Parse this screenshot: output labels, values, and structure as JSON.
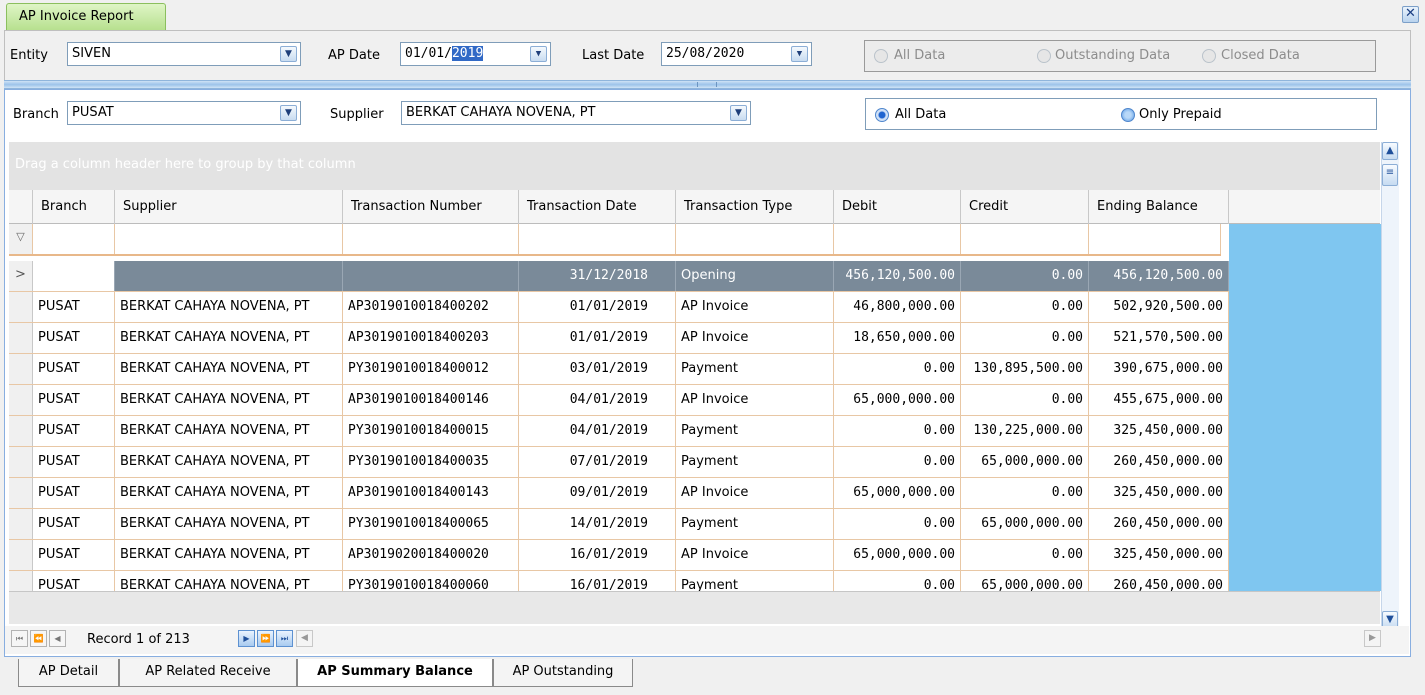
{
  "doc_tab": "AP Invoice Report",
  "filters_top": {
    "entity_label": "Entity",
    "entity_value": "SIVEN",
    "ap_date_label": "AP Date",
    "ap_date_prefix": "01/01/",
    "ap_date_selected": "2019",
    "last_date_label": "Last Date",
    "last_date_value": "25/08/2020",
    "radio_all": "All Data",
    "radio_outstanding": "Outstanding Data",
    "radio_closed": "Closed Data"
  },
  "filters_main": {
    "branch_label": "Branch",
    "branch_value": "PUSAT",
    "supplier_label": "Supplier",
    "supplier_value": "BERKAT CAHAYA NOVENA, PT",
    "radio_all": "All Data",
    "radio_prepaid": "Only Prepaid"
  },
  "grid": {
    "group_hint": "Drag a column header here to group by that column",
    "columns": [
      "Branch",
      "Supplier",
      "Transaction Number",
      "Transaction Date",
      "Transaction Type",
      "Debit",
      "Credit",
      "Ending Balance"
    ],
    "opening_row": {
      "branch": "",
      "supplier": "",
      "number": "",
      "date": "31/12/2018",
      "type": "Opening",
      "debit": "456,120,500.00",
      "credit": "0.00",
      "balance": "456,120,500.00"
    },
    "rows": [
      {
        "branch": "PUSAT",
        "supplier": "BERKAT CAHAYA NOVENA, PT",
        "number": "AP3019010018400202",
        "date": "01/01/2019",
        "type": "AP Invoice",
        "debit": "46,800,000.00",
        "credit": "0.00",
        "balance": "502,920,500.00"
      },
      {
        "branch": "PUSAT",
        "supplier": "BERKAT CAHAYA NOVENA, PT",
        "number": "AP3019010018400203",
        "date": "01/01/2019",
        "type": "AP Invoice",
        "debit": "18,650,000.00",
        "credit": "0.00",
        "balance": "521,570,500.00"
      },
      {
        "branch": "PUSAT",
        "supplier": "BERKAT CAHAYA NOVENA, PT",
        "number": "PY3019010018400012",
        "date": "03/01/2019",
        "type": "Payment",
        "debit": "0.00",
        "credit": "130,895,500.00",
        "balance": "390,675,000.00"
      },
      {
        "branch": "PUSAT",
        "supplier": "BERKAT CAHAYA NOVENA, PT",
        "number": "AP3019010018400146",
        "date": "04/01/2019",
        "type": "AP Invoice",
        "debit": "65,000,000.00",
        "credit": "0.00",
        "balance": "455,675,000.00"
      },
      {
        "branch": "PUSAT",
        "supplier": "BERKAT CAHAYA NOVENA, PT",
        "number": "PY3019010018400015",
        "date": "04/01/2019",
        "type": "Payment",
        "debit": "0.00",
        "credit": "130,225,000.00",
        "balance": "325,450,000.00"
      },
      {
        "branch": "PUSAT",
        "supplier": "BERKAT CAHAYA NOVENA, PT",
        "number": "PY3019010018400035",
        "date": "07/01/2019",
        "type": "Payment",
        "debit": "0.00",
        "credit": "65,000,000.00",
        "balance": "260,450,000.00"
      },
      {
        "branch": "PUSAT",
        "supplier": "BERKAT CAHAYA NOVENA, PT",
        "number": "AP3019010018400143",
        "date": "09/01/2019",
        "type": "AP Invoice",
        "debit": "65,000,000.00",
        "credit": "0.00",
        "balance": "325,450,000.00"
      },
      {
        "branch": "PUSAT",
        "supplier": "BERKAT CAHAYA NOVENA, PT",
        "number": "PY3019010018400065",
        "date": "14/01/2019",
        "type": "Payment",
        "debit": "0.00",
        "credit": "65,000,000.00",
        "balance": "260,450,000.00"
      },
      {
        "branch": "PUSAT",
        "supplier": "BERKAT CAHAYA NOVENA, PT",
        "number": "AP3019020018400020",
        "date": "16/01/2019",
        "type": "AP Invoice",
        "debit": "65,000,000.00",
        "credit": "0.00",
        "balance": "325,450,000.00"
      },
      {
        "branch": "PUSAT",
        "supplier": "BERKAT CAHAYA NOVENA, PT",
        "number": "PY3019010018400060",
        "date": "16/01/2019",
        "type": "Payment",
        "debit": "0.00",
        "credit": "65,000,000.00",
        "balance": "260,450,000.00"
      }
    ]
  },
  "navigator": {
    "record_text": "Record 1 of 213"
  },
  "bottom_tabs": [
    "AP Detail",
    "AP Related Receive",
    "AP Summary Balance",
    "AP Outstanding"
  ],
  "icons": {
    "close": "close-icon",
    "dropdown": "chevron-down-icon",
    "filter": "filter-icon",
    "row_indicator": "chevron-right-icon"
  },
  "colors": {
    "tab_green": "#b7e08f",
    "opening_row": "#7a8a99",
    "grid_empty": "#7fc6f0",
    "grid_border": "#e8c7a5",
    "selection": "#3169c6"
  }
}
